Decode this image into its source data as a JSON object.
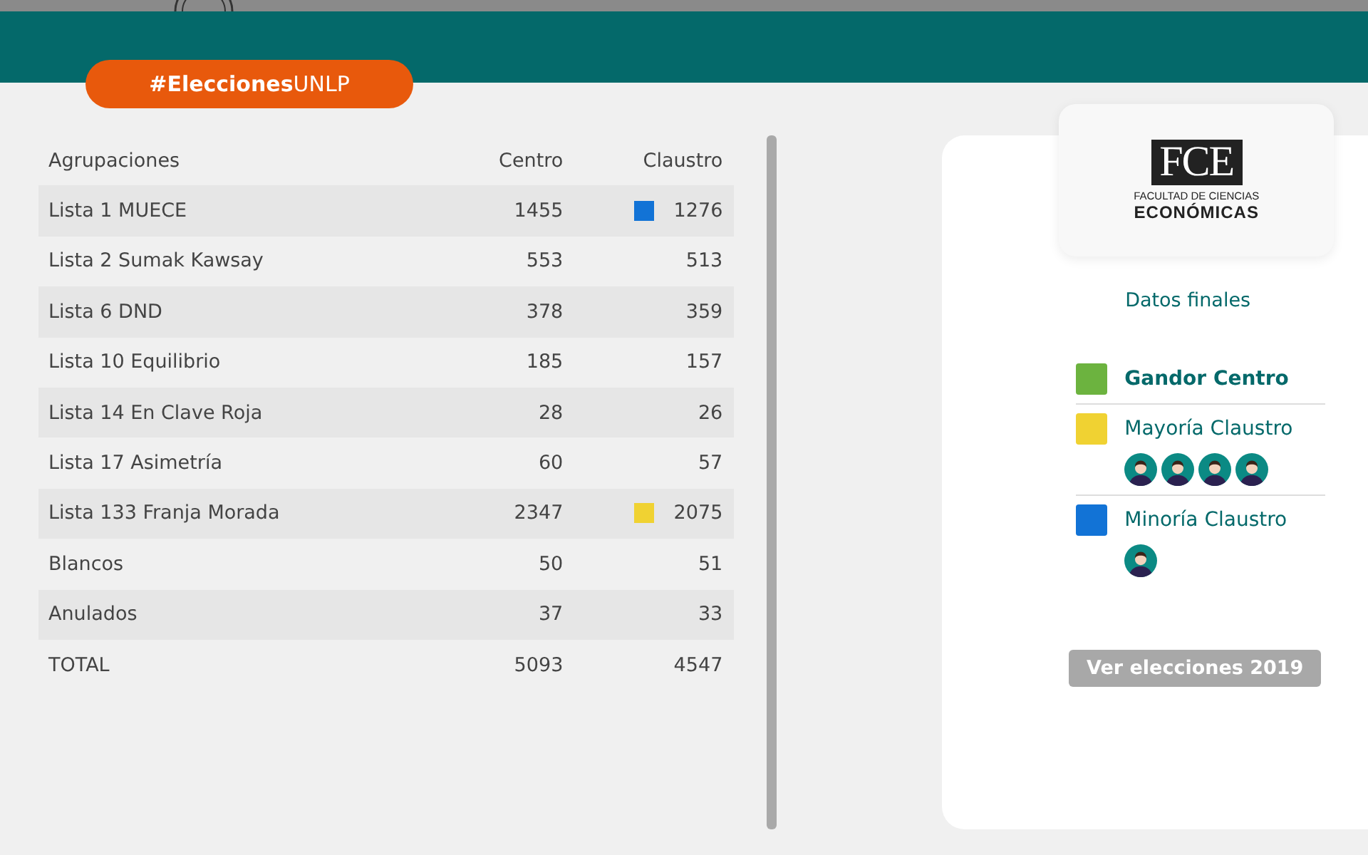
{
  "banner": {
    "hashtag_bold": "#Elecciones",
    "hashtag_rest": "UNLP"
  },
  "table": {
    "columns": [
      "Agrupaciones",
      "Centro",
      "Claustro"
    ],
    "rows": [
      {
        "name": "Lista 1 MUECE",
        "centro": "1455",
        "claustro": "1276",
        "color": "#1273d6"
      },
      {
        "name": "Lista 2 Sumak Kawsay",
        "centro": "553",
        "claustro": "513"
      },
      {
        "name": "Lista 6 DND",
        "centro": "378",
        "claustro": "359"
      },
      {
        "name": "Lista 10 Equilibrio",
        "centro": "185",
        "claustro": "157"
      },
      {
        "name": "Lista 14 En Clave Roja",
        "centro": "28",
        "claustro": "26"
      },
      {
        "name": "Lista 17 Asimetría",
        "centro": "60",
        "claustro": "57"
      },
      {
        "name": "Lista 133 Franja Morada",
        "centro": "2347",
        "claustro": "2075",
        "color": "#f0d232"
      },
      {
        "name": "Blancos",
        "centro": "50",
        "claustro": "51"
      },
      {
        "name": "Anulados",
        "centro": "37",
        "claustro": "33"
      },
      {
        "name": "TOTAL",
        "centro": "5093",
        "claustro": "4547"
      }
    ]
  },
  "logo": {
    "initials": "FCE",
    "line_1": "FACULTAD DE CIENCIAS",
    "line_2": "ECONÓMICAS"
  },
  "results": {
    "title": "Datos finales",
    "items": [
      {
        "label": "Gandor Centro",
        "color": "#6cb33f",
        "bold": true
      },
      {
        "label": "Mayoría Claustro",
        "color": "#f0d232",
        "bold": false,
        "members": [
          {
            "kind": "avatar"
          },
          {
            "kind": "avatar"
          },
          {
            "kind": "avatar"
          },
          {
            "kind": "avatar"
          }
        ]
      },
      {
        "label": "Minoría Claustro",
        "color": "#1273d6",
        "bold": false,
        "members": [
          {
            "kind": "avatar"
          }
        ]
      }
    ],
    "button": "Ver elecciones 2019"
  }
}
